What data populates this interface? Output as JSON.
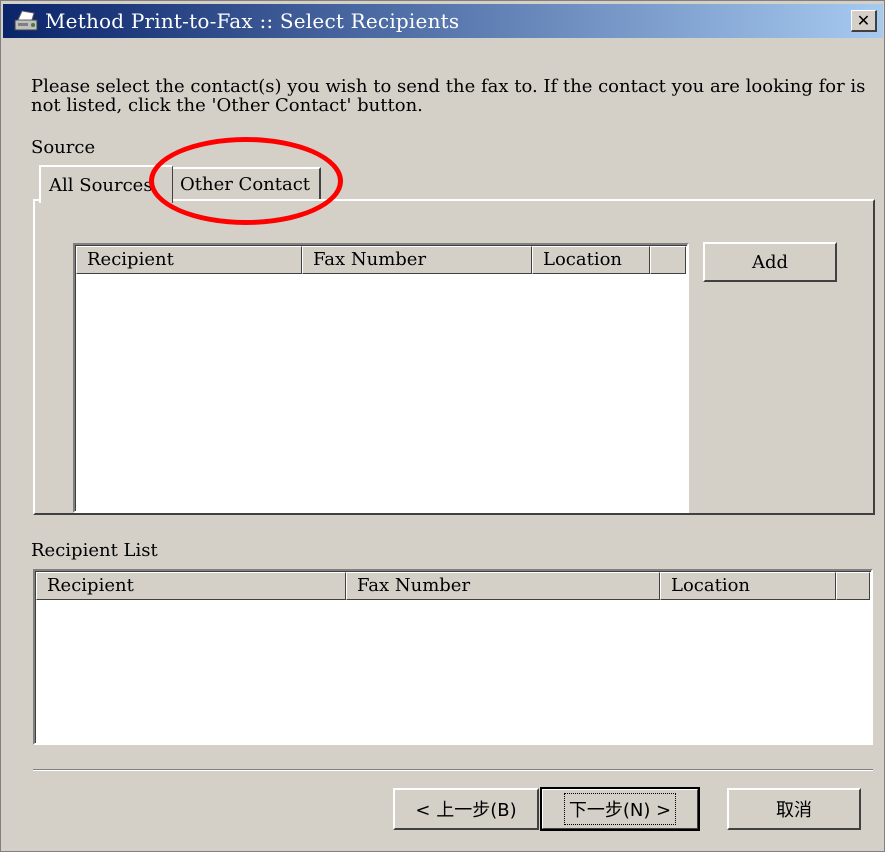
{
  "window": {
    "title": "Method Print-to-Fax :: Select Recipients",
    "close_glyph": "✕",
    "title_icon": "fax-printer-icon"
  },
  "instructions": "Please select the contact(s) you wish to send the fax to. If the contact you are looking for is not listed, click the 'Other Contact' button.",
  "source": {
    "label": "Source",
    "tabs": [
      {
        "label": "All Sources",
        "selected": true
      },
      {
        "label": "Other Contact",
        "selected": false
      }
    ],
    "columns": [
      "Recipient",
      "Fax Number",
      "Location"
    ],
    "rows": [],
    "add_label": "Add"
  },
  "recipient_list": {
    "label": "Recipient List",
    "columns": [
      "Recipient",
      "Fax Number",
      "Location"
    ],
    "rows": []
  },
  "buttons": {
    "back": "< 上一步(B)",
    "next": "下一步(N) >",
    "cancel": "取消"
  },
  "annotation": {
    "color": "#ff0000",
    "target": "Other Contact"
  }
}
